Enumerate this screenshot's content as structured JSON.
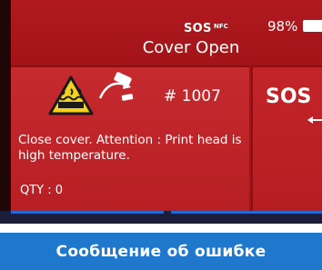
{
  "status_bar": {
    "sos_indicator": "SOS",
    "nfc_indicator": "NFC",
    "battery_percent": "98%",
    "battery_level": 0.98
  },
  "header": {
    "title": "Cover Open"
  },
  "error_card": {
    "error_code": "# 1007",
    "message": "Close cover. Attention : Print head is high temperature.",
    "qty": "QTY : 0",
    "icons": [
      "hot-surface-warning-icon",
      "print-head-icon"
    ]
  },
  "side_panel": {
    "sos_button_label": "SOS",
    "arrow_icon": "arrow-left-icon"
  },
  "caption": {
    "text": "Сообщение об ошибке"
  },
  "colors": {
    "background": "#a01318",
    "card": "#c42a2e",
    "warning_yellow": "#f3d11e",
    "caption_blue": "#1f78cc"
  }
}
